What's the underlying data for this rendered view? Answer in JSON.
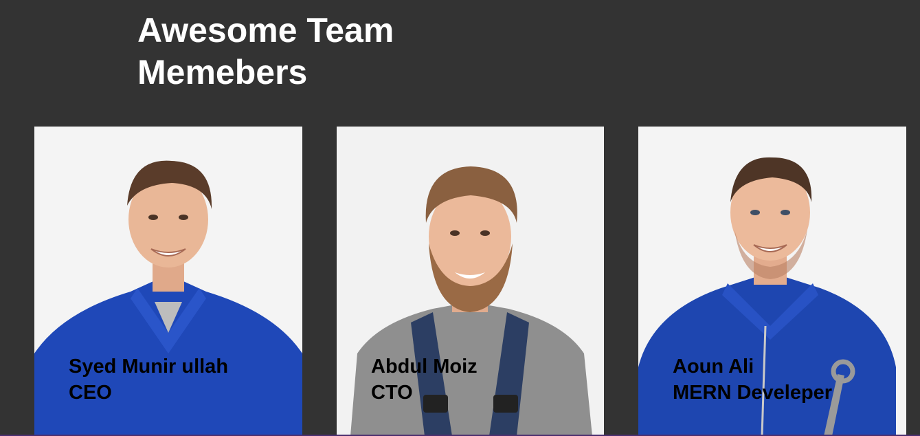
{
  "section": {
    "title_line1": "Awesome Team",
    "title_line2": "Memebers"
  },
  "members": [
    {
      "name": "Syed Munir ullah",
      "role": "CEO",
      "photo": "man-blue-workwear-photo"
    },
    {
      "name": "Abdul Moiz",
      "role": "CTO",
      "photo": "bearded-man-overalls-photo"
    },
    {
      "name": "Aoun Ali",
      "role": "MERN Develeper",
      "photo": "man-coverall-wrench-photo"
    }
  ],
  "colors": {
    "background": "#333333",
    "card": "#f4f4f4",
    "title": "#ffffff",
    "caption": "#000000",
    "workwear_blue": "#1f48b8",
    "overalls_navy": "#2c3e63"
  }
}
